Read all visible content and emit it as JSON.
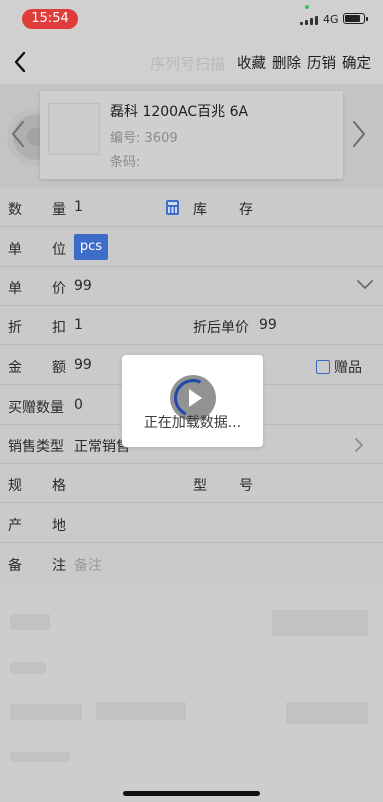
{
  "status_bar": {
    "time": "15:54",
    "network": "4G"
  },
  "nav": {
    "back_icon": "chevron-left-icon",
    "title": "序列号扫描",
    "actions": [
      "收藏",
      "删除",
      "历销",
      "确定"
    ]
  },
  "product": {
    "name": "磊科  1200AC百兆     6A",
    "code_label": "编号:",
    "code_value": "3609",
    "barcode_label": "条码:",
    "barcode_value": ""
  },
  "form": {
    "quantity": {
      "label_a": "数",
      "label_b": "量",
      "value": "1"
    },
    "stock": {
      "label_a": "库",
      "label_b": "存",
      "value": ""
    },
    "unit": {
      "label_a": "单",
      "label_b": "位",
      "value": "pcs"
    },
    "price": {
      "label_a": "单",
      "label_b": "价",
      "value": "99"
    },
    "discount": {
      "label_a": "折",
      "label_b": "扣",
      "value": "1"
    },
    "discount_price": {
      "label": "折后单价",
      "value": "99"
    },
    "amount": {
      "label_a": "金",
      "label_b": "额",
      "value": "99"
    },
    "gift": {
      "label": "赠品",
      "checked": false
    },
    "gift_qty": {
      "label": "买赠数量",
      "value": "0"
    },
    "sale_type": {
      "label": "销售类型",
      "value": "正常销售"
    },
    "spec": {
      "label_a": "规",
      "label_b": "格",
      "value": ""
    },
    "model": {
      "label_a": "型",
      "label_b": "号",
      "value": ""
    },
    "origin": {
      "label_a": "产",
      "label_b": "地",
      "value": ""
    },
    "remark": {
      "label_a": "备",
      "label_b": "注",
      "placeholder": "备注"
    }
  },
  "loading": {
    "text": "正在加载数据..."
  },
  "colors": {
    "accent": "#3d6cc8",
    "time_pill": "#e03c3c"
  }
}
